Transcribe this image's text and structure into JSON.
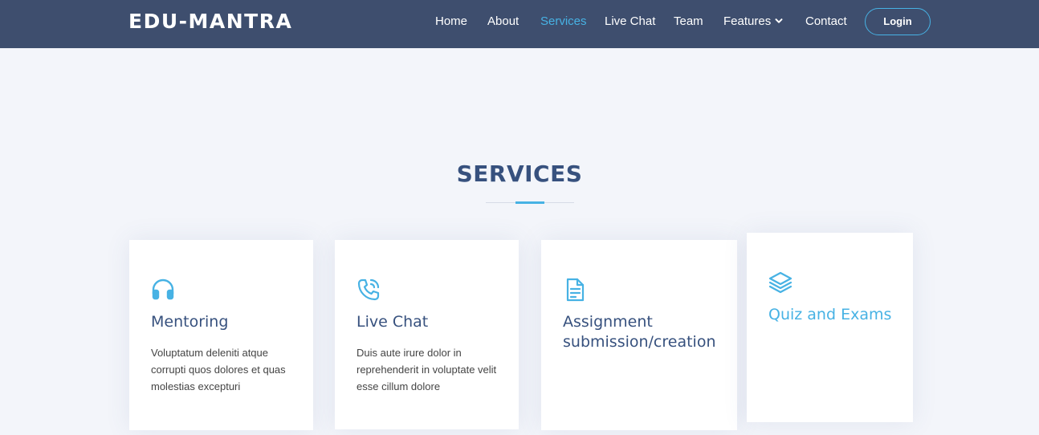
{
  "header": {
    "logo": "EDU-MANTRA",
    "nav": [
      {
        "label": "Home",
        "active": false
      },
      {
        "label": "About",
        "active": false
      },
      {
        "label": "Services",
        "active": true
      },
      {
        "label": "Live Chat",
        "active": false
      },
      {
        "label": "Team",
        "active": false
      },
      {
        "label": "Features",
        "active": false,
        "dropdown": true
      },
      {
        "label": "Contact",
        "active": false
      }
    ],
    "login_label": "Login"
  },
  "services": {
    "title": "SERVICES",
    "cards": [
      {
        "icon": "headphones-icon",
        "title": "Mentoring",
        "description": "Voluptatum deleniti atque corrupti quos dolores et quas molestias excepturi"
      },
      {
        "icon": "phone-call-icon",
        "title": "Live Chat",
        "description": "Duis aute irure dolor in reprehenderit in voluptate velit esse cillum dolore"
      },
      {
        "icon": "file-text-icon",
        "title": "Assignment submission/creation",
        "description": ""
      },
      {
        "icon": "layers-icon",
        "title": "Quiz and Exams",
        "description": ""
      }
    ]
  },
  "colors": {
    "header_bg": "#3e4e6e",
    "accent": "#47b2e4",
    "heading": "#37517e",
    "page_bg": "#f3f5fa"
  }
}
